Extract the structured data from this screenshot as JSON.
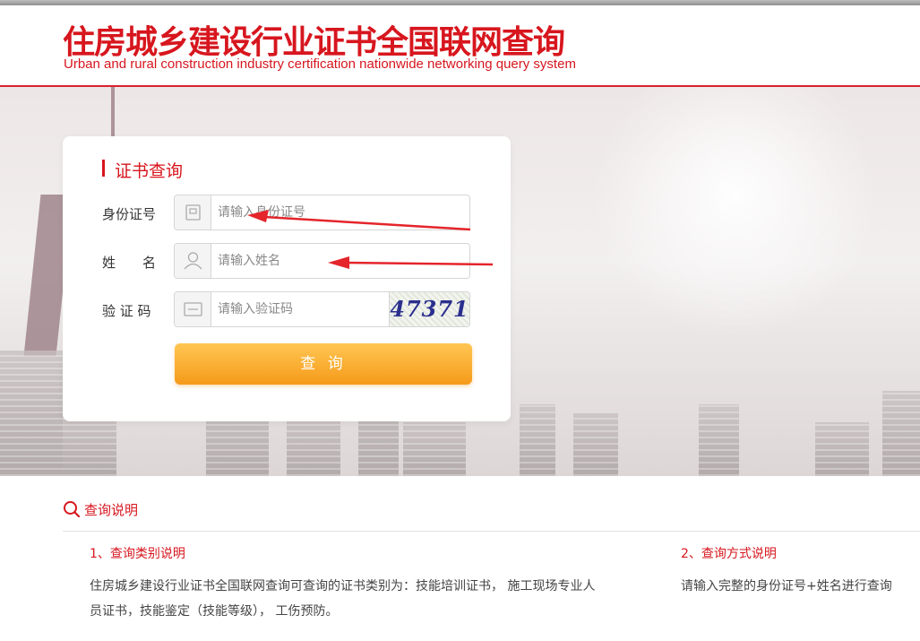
{
  "header": {
    "title": "住房城乡建设行业证书全国联网查询",
    "subtitle": "Urban and rural construction industry certification nationwide networking query system"
  },
  "form": {
    "title": "证书查询",
    "id_label": "身份证号",
    "id_placeholder": "请输入身份证号",
    "name_label": "姓　　名",
    "name_placeholder": "请输入姓名",
    "captcha_label": "验 证 码",
    "captcha_placeholder": "请输入验证码",
    "captcha_text": "47371",
    "submit_label": "查 询"
  },
  "info": {
    "heading": "查询说明",
    "section1_title": "1、查询类别说明",
    "section1_body": "住房城乡建设行业证书全国联网查询可查询的证书类别为：技能培训证书， 施工现场专业人员证书，技能鉴定（技能等级）， 工伤预防。",
    "section2_title": "2、查询方式说明",
    "section2_body": "请输入完整的身份证号+姓名进行查询"
  },
  "colors": {
    "brand_red": "#d7161e",
    "button_orange": "#f59a1a",
    "annotation_arrow": "#e4252b"
  },
  "icons": [
    "id-card-icon",
    "user-icon",
    "captcha-icon",
    "search-icon",
    "arrow-annotation-icon"
  ]
}
